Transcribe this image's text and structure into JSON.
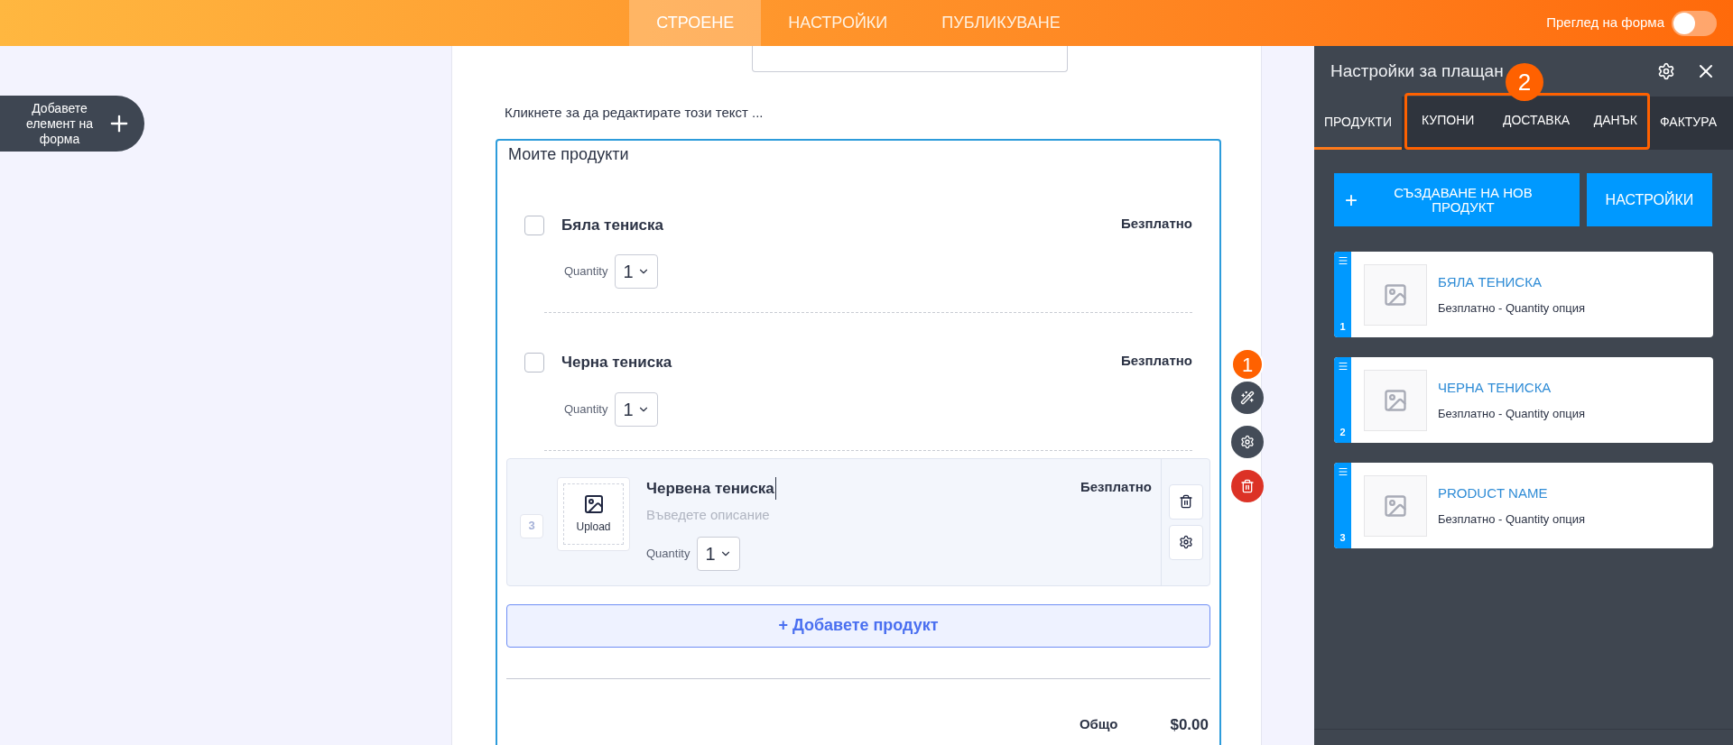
{
  "top_bar": {
    "tabs": [
      {
        "label": "СТРОЕНЕ",
        "selected": true
      },
      {
        "label": "НАСТРОЙКИ",
        "selected": false
      },
      {
        "label": "ПУБЛИКУВАНЕ",
        "selected": false
      }
    ],
    "preview_toggle": {
      "label": "Преглед на форма",
      "on": false
    }
  },
  "add_element_button": {
    "label": "Добавете елемент на форма"
  },
  "form": {
    "intro_text": "Кликнете за да редактирате този текст ...",
    "products_widget": {
      "title": "Моите продукти",
      "products": [
        {
          "kind": "listed",
          "name": "Бяла тениска",
          "price": "Безплатно",
          "quantity_label": "Quantity",
          "quantity": "1",
          "checked": false
        },
        {
          "kind": "listed",
          "name": "Черна тениска",
          "price": "Безплатно",
          "quantity_label": "Quantity",
          "quantity": "1",
          "checked": false
        },
        {
          "kind": "editing",
          "index": "3",
          "upload_label": "Upload",
          "name": "Червена тениска",
          "description_placeholder": "Въведете описание",
          "price": "Безплатно",
          "quantity_label": "Quantity",
          "quantity": "1"
        }
      ],
      "add_button": "+ Добавете продукт",
      "total_label": "Общо",
      "total": "$0.00"
    }
  },
  "annotations": [
    {
      "label": "1"
    },
    {
      "label": "2"
    }
  ],
  "side_panel": {
    "title": "Настройки за плащан",
    "tabs": [
      {
        "label": "ПРОДУКТИ",
        "selected": true
      },
      {
        "label": "КУПОНИ",
        "selected": false
      },
      {
        "label": "ДОСТАВКА",
        "selected": false
      },
      {
        "label": "ДАНЪК",
        "selected": false
      },
      {
        "label": "ФАКТУРА",
        "selected": false
      }
    ],
    "create_button": {
      "icon": "+",
      "label": "СЪЗДАВАНЕ НА НОВ ПРОДУКТ"
    },
    "settings_button": "НАСТРОЙКИ",
    "products": [
      {
        "number": "1",
        "name": "БЯЛА ТЕНИСКА",
        "detail": "Безплатно - Quantity опция"
      },
      {
        "number": "2",
        "name": "ЧЕРНА ТЕНИСКА",
        "detail": "Безплатно - Quantity опция"
      },
      {
        "number": "3",
        "name": "PRODUCT NAME",
        "detail": "Безплатно - Quantity опция"
      }
    ]
  }
}
